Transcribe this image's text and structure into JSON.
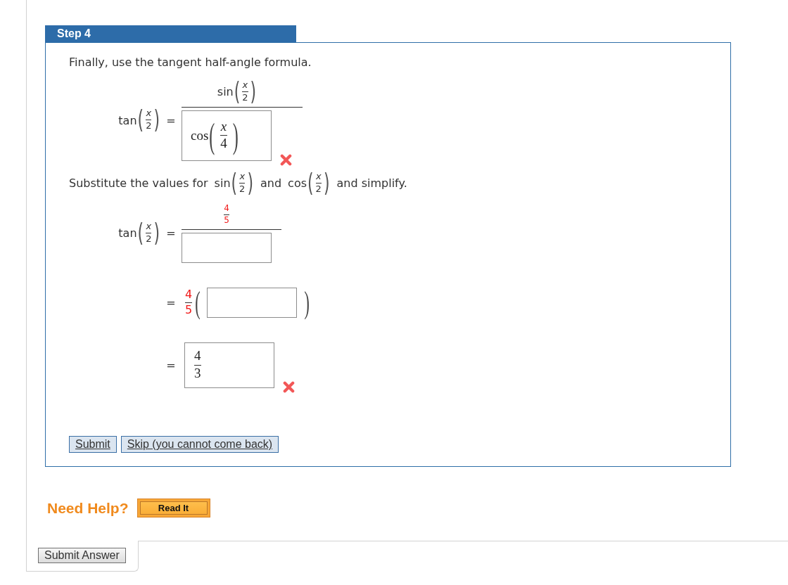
{
  "step": {
    "title": "Step 4"
  },
  "blocks": [
    {
      "kind": "text",
      "text": "Finally, use the tangent half-angle formula."
    },
    {
      "kind": "equation",
      "lhs": [
        {
          "kind": "func",
          "name": "tan",
          "open": "(",
          "close": ")",
          "arg": [
            {
              "kind": "frac",
              "num": [
                {
                  "kind": "var",
                  "text": "x",
                  "highlighted": false
                }
              ],
              "den": [
                {
                  "kind": "num",
                  "text": "2",
                  "highlighted": false
                }
              ]
            }
          ]
        }
      ],
      "relation": "=",
      "rhs": [
        {
          "kind": "frac",
          "num": [
            {
              "kind": "func",
              "name": "sin",
              "open": "(",
              "close": ")",
              "arg": [
                {
                  "kind": "frac",
                  "num": [
                    {
                      "kind": "var",
                      "text": "x",
                      "highlighted": false
                    }
                  ],
                  "den": [
                    {
                      "kind": "num",
                      "text": "2",
                      "highlighted": false
                    }
                  ]
                }
              ]
            }
          ],
          "den": [
            {
              "kind": "answer",
              "value": [
                {
                  "kind": "func",
                  "name": "cos",
                  "open": "(",
                  "close": ")",
                  "arg": [
                    {
                      "kind": "frac",
                      "num": [
                        {
                          "kind": "var",
                          "text": "x",
                          "highlighted": false
                        }
                      ],
                      "den": [
                        {
                          "kind": "num",
                          "text": "4",
                          "highlighted": false
                        }
                      ]
                    }
                  ]
                }
              ]
            },
            {
              "kind": "mark",
              "correct": false
            }
          ]
        }
      ]
    },
    {
      "kind": "paragraph",
      "parts": [
        {
          "kind": "text",
          "text": "Substitute the values for"
        },
        {
          "kind": "func",
          "name": "sin",
          "open": "(",
          "close": ")",
          "arg": [
            {
              "kind": "frac",
              "num": [
                {
                  "kind": "var",
                  "text": "x",
                  "highlighted": false
                }
              ],
              "den": [
                {
                  "kind": "num",
                  "text": "2",
                  "highlighted": false
                }
              ]
            }
          ]
        },
        {
          "kind": "text",
          "text": "and"
        },
        {
          "kind": "func",
          "name": "cos",
          "open": "(",
          "close": ")",
          "arg": [
            {
              "kind": "frac",
              "num": [
                {
                  "kind": "var",
                  "text": "x",
                  "highlighted": false
                }
              ],
              "den": [
                {
                  "kind": "num",
                  "text": "2",
                  "highlighted": false
                }
              ]
            }
          ]
        },
        {
          "kind": "text",
          "text": "and simplify."
        }
      ]
    },
    {
      "kind": "equation",
      "lhs": [
        {
          "kind": "func",
          "name": "tan",
          "open": "(",
          "close": ")",
          "arg": [
            {
              "kind": "frac",
              "num": [
                {
                  "kind": "var",
                  "text": "x",
                  "highlighted": false
                }
              ],
              "den": [
                {
                  "kind": "num",
                  "text": "2",
                  "highlighted": false
                }
              ]
            }
          ]
        }
      ],
      "relation": "=",
      "rhs": [
        {
          "kind": "frac",
          "num": [
            {
              "kind": "frac",
              "num": [
                {
                  "kind": "num",
                  "text": "4",
                  "highlighted": true
                }
              ],
              "den": [
                {
                  "kind": "num",
                  "text": "5",
                  "highlighted": true
                }
              ]
            }
          ],
          "den": [
            {
              "kind": "answer"
            }
          ]
        }
      ]
    },
    {
      "kind": "equation",
      "relation": "=",
      "rhs": [
        {
          "kind": "frac",
          "num": [
            {
              "kind": "num",
              "text": "4",
              "highlighted": true
            }
          ],
          "den": [
            {
              "kind": "num",
              "text": "5",
              "highlighted": true
            }
          ]
        },
        {
          "kind": "group",
          "open": "(",
          "close": ")",
          "content": [
            {
              "kind": "answer"
            }
          ]
        }
      ]
    },
    {
      "kind": "equation",
      "relation": "=",
      "rhs": [
        {
          "kind": "answer",
          "value": [
            {
              "kind": "frac",
              "num": [
                {
                  "kind": "num",
                  "text": "4",
                  "highlighted": false
                }
              ],
              "den": [
                {
                  "kind": "num",
                  "text": "3",
                  "highlighted": false
                }
              ]
            }
          ]
        },
        {
          "kind": "mark",
          "correct": false
        }
      ]
    }
  ],
  "actions": [
    {
      "label": "Submit"
    },
    {
      "label": "Skip (you cannot come back)"
    }
  ],
  "help": {
    "title": "Need Help?",
    "button": "Read It"
  },
  "footer": {
    "button": "Submit Answer"
  }
}
